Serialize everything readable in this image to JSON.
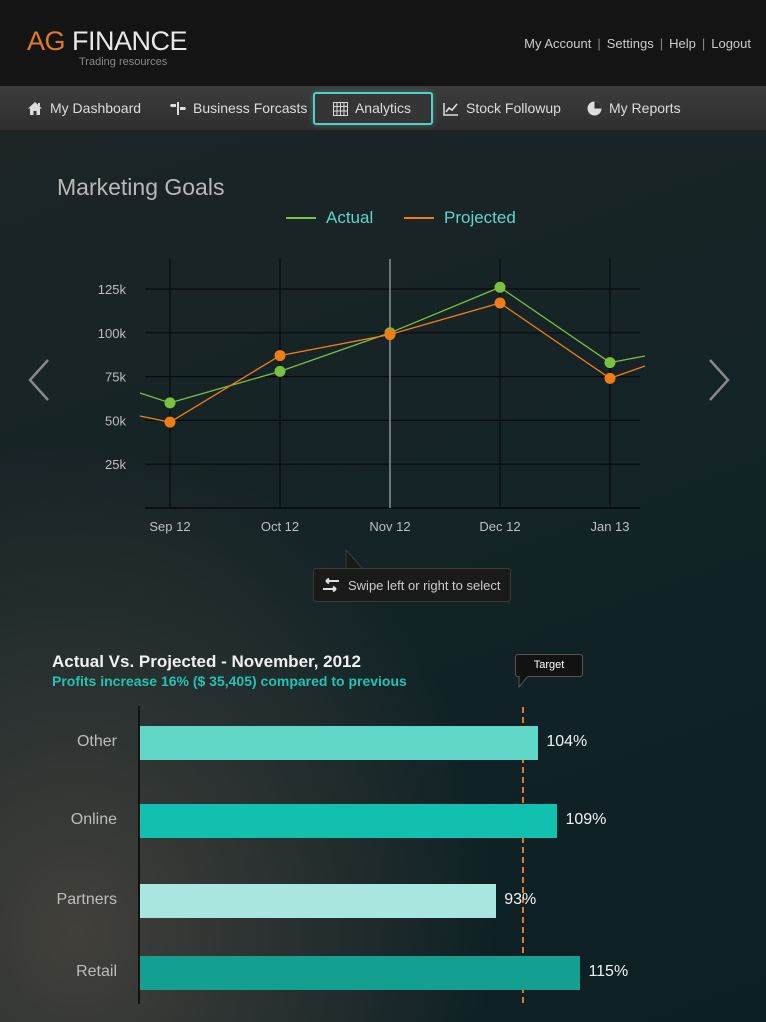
{
  "header": {
    "logo_ag": "AG",
    "logo_finance": "FINANCE",
    "tagline": "Trading resources",
    "links": [
      "My Account",
      "Settings",
      "Help",
      "Logout"
    ]
  },
  "nav": {
    "items": [
      {
        "label": "My Dashboard",
        "icon": "home-icon"
      },
      {
        "label": "Business Forcasts",
        "icon": "signpost-icon"
      },
      {
        "label": "Analytics",
        "icon": "grid-icon",
        "active": true
      },
      {
        "label": "Stock Followup",
        "icon": "line-chart-icon"
      },
      {
        "label": "My Reports",
        "icon": "pie-chart-icon"
      }
    ]
  },
  "line_section": {
    "title": "Marketing Goals",
    "legend_actual": "Actual",
    "legend_projected": "Projected",
    "tooltip": "Swipe left or right to select"
  },
  "bar_section": {
    "title": "Actual Vs. Projected - November, 2012",
    "subtitle": "Profits increase 16% ($ 35,405) compared to previous",
    "target_label": "Target"
  },
  "colors": {
    "accent": "#52d0c5",
    "actual": "#7ac142",
    "projected": "#f07d16",
    "target": "#e07a28"
  },
  "chart_data": [
    {
      "type": "line",
      "title": "Marketing Goals",
      "categories": [
        "Sep 12",
        "Oct 12",
        "Nov 12",
        "Dec 12",
        "Jan 13"
      ],
      "y_ticks": [
        "25k",
        "50k",
        "75k",
        "100k",
        "125k"
      ],
      "ylim": [
        0,
        125000
      ],
      "series": [
        {
          "name": "Actual",
          "values": [
            60000,
            78000,
            100000,
            126000,
            83000
          ]
        },
        {
          "name": "Projected",
          "values": [
            49000,
            87000,
            99000,
            117000,
            74000
          ]
        }
      ],
      "selected_category": "Nov 12",
      "grid": true,
      "legend": "top-center"
    },
    {
      "type": "bar",
      "orientation": "horizontal",
      "title": "Actual Vs. Projected - November, 2012",
      "categories": [
        "Other",
        "Online",
        "Partners",
        "Retail"
      ],
      "values": [
        104,
        109,
        93,
        115
      ],
      "value_labels": [
        "104%",
        "109%",
        "93%",
        "115%"
      ],
      "target": 100,
      "bar_colors": [
        "#5fd6c8",
        "#12c0b0",
        "#a8e6df",
        "#13a091"
      ]
    }
  ]
}
